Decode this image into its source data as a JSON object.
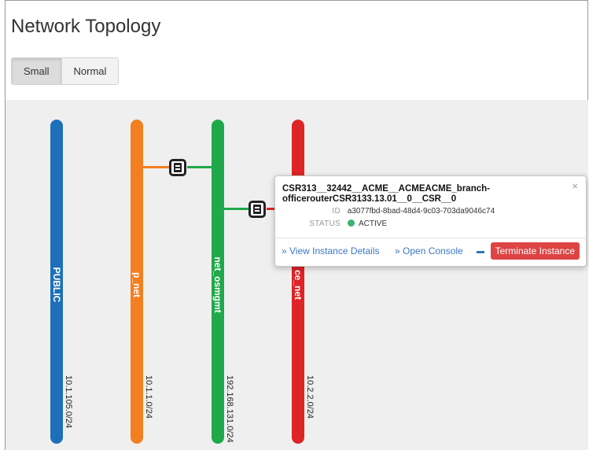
{
  "page": {
    "title": "Network Topology"
  },
  "size_toggle": {
    "small_label": "Small",
    "normal_label": "Normal",
    "selected": "Small"
  },
  "networks": [
    {
      "name": "PUBLIC",
      "cidr": "10.1.105.0/24",
      "color": "#1d70b7"
    },
    {
      "name": "p_net",
      "cidr": "10.1.1.0/24",
      "color": "#f47f20"
    },
    {
      "name": "net_osmgmt",
      "cidr": "192.168.131.0/24",
      "color": "#1fa94a"
    },
    {
      "name": "ce_net",
      "cidr": "10.2.2.0/24",
      "color": "#de2426"
    }
  ],
  "popup": {
    "close": "×",
    "name_line1": "CSR313__32442__ACME__ACMEACME_branch-",
    "name_line2": "officerouterCSR3133.13.01__0__CSR__0",
    "id_label": "ID",
    "id_value": "a3077fbd-8bad-48d4-9c03-703da9046c74",
    "status_label": "STATUS",
    "status_value": "ACTIVE",
    "status_color": "#3cb371",
    "view_details": "» View Instance Details",
    "open_console": "» Open Console",
    "terminate": "Terminate Instance"
  },
  "icons": {
    "instance": "server-icon",
    "close": "close-icon",
    "status": "status-dot-icon"
  }
}
